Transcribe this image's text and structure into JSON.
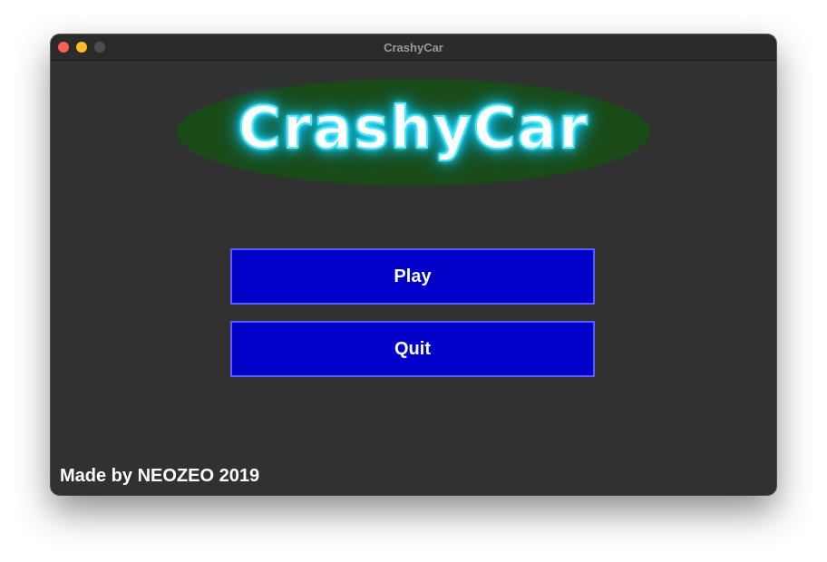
{
  "window": {
    "title": "CrashyCar",
    "controls": {
      "close": "close-button",
      "minimize": "minimize-button",
      "maximize": "maximize-button"
    }
  },
  "logo": {
    "text": "CrashyCar",
    "glow_color": "#00c8ff",
    "background_color": "#1a4a17"
  },
  "menu": {
    "play_label": "Play",
    "quit_label": "Quit",
    "button_color": "#0000c8"
  },
  "footer": {
    "credit": "Made by NEOZEO 2019"
  }
}
